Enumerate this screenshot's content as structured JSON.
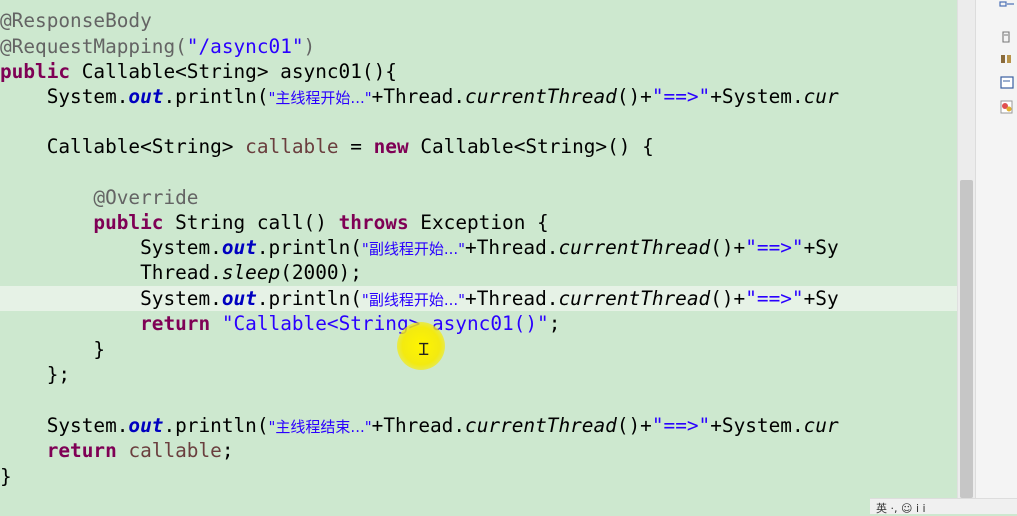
{
  "editor": {
    "line1": [
      "@ResponseBody"
    ],
    "line2": [
      "@RequestMapping(",
      "\"/async01\"",
      ")"
    ],
    "line3": [
      "public",
      " Callable<String> async01(){"
    ],
    "line4": [
      "    System.",
      "out",
      ".println(",
      "\"主线程开始...\"",
      "+Thread.",
      "currentThread",
      "()+",
      "\"==>\"",
      "+System.",
      "cur"
    ],
    "line6": [
      "    Callable<String> ",
      "callable",
      " = ",
      "new",
      " Callable<String>() {"
    ],
    "line8": [
      "        @Override"
    ],
    "line9": [
      "        ",
      "public",
      " String call() ",
      "throws",
      " Exception {"
    ],
    "line10": [
      "            System.",
      "out",
      ".println(",
      "\"副线程开始...\"",
      "+Thread.",
      "currentThread",
      "()+",
      "\"==>\"",
      "+Sy"
    ],
    "line11": [
      "            Thread.",
      "sleep",
      "(2000);"
    ],
    "line12": [
      "            System.",
      "out",
      ".println(",
      "\"副线程开始...\"",
      "+Thread.",
      "currentThread",
      "()+",
      "\"==>\"",
      "+Sy"
    ],
    "line13": [
      "            ",
      "return",
      " ",
      "\"Callable<String> async01()\"",
      ";"
    ],
    "line14": [
      "        }"
    ],
    "line15": [
      "    };"
    ],
    "line17": [
      "    System.",
      "out",
      ".println(",
      "\"主线程结束...\"",
      "+Thread.",
      "currentThread",
      "()+",
      "\"==>\"",
      "+System.",
      "cur"
    ],
    "line18": [
      "    ",
      "return",
      " ",
      "callable",
      ";"
    ],
    "line19": [
      "}"
    ]
  },
  "taskbar": {
    "text": "英 ·, ☺ ⅰ ⅰ"
  },
  "colors": {
    "background": "#cde8cf",
    "keyword": "#7f0055",
    "string": "#2a00ff",
    "annotation": "#646464",
    "field": "#0000c0",
    "local_var": "#6a3e3e",
    "current_line": "#e6f2e6",
    "cursor_highlight": "#f3ea10"
  }
}
